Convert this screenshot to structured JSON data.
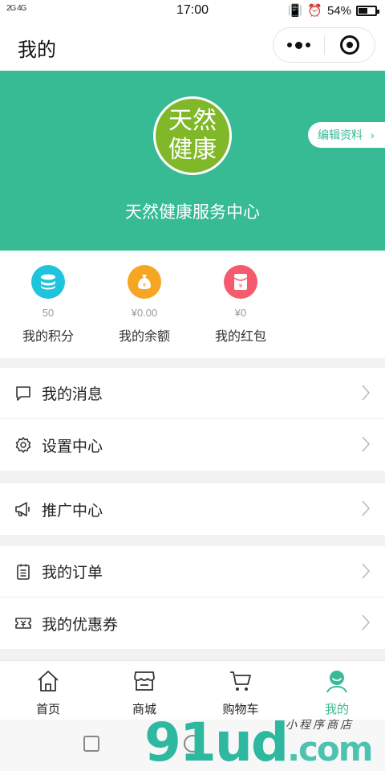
{
  "status": {
    "signal": "2G 4G",
    "time": "17:00",
    "battery": "54%",
    "battery_level": 0.54
  },
  "nav": {
    "title": "我的"
  },
  "profile": {
    "logo_line1": "天然",
    "logo_line2": "健康",
    "name": "天然健康服务中心",
    "edit_label": "编辑资料"
  },
  "assets": [
    {
      "value": "50",
      "label": "我的积分",
      "icon": "coins-icon",
      "color": "#1fc3dc"
    },
    {
      "value": "¥0.00",
      "label": "我的余额",
      "icon": "money-bag-icon",
      "color": "#f6a623"
    },
    {
      "value": "¥0",
      "label": "我的红包",
      "icon": "red-envelope-icon",
      "color": "#f45b6c"
    }
  ],
  "menu": {
    "messages": "我的消息",
    "settings": "设置中心",
    "promotion": "推广中心",
    "orders": "我的订单",
    "coupons": "我的优惠券"
  },
  "tabs": [
    {
      "label": "首页",
      "icon": "home-icon"
    },
    {
      "label": "商城",
      "icon": "store-icon"
    },
    {
      "label": "购物车",
      "icon": "cart-icon"
    },
    {
      "label": "我的",
      "icon": "user-icon",
      "active": true
    }
  ],
  "watermark": {
    "text": "91ud",
    "suffix": ".com",
    "sub": "小程序商店"
  },
  "colors": {
    "accent": "#36bb95",
    "logo": "#80b82a"
  }
}
